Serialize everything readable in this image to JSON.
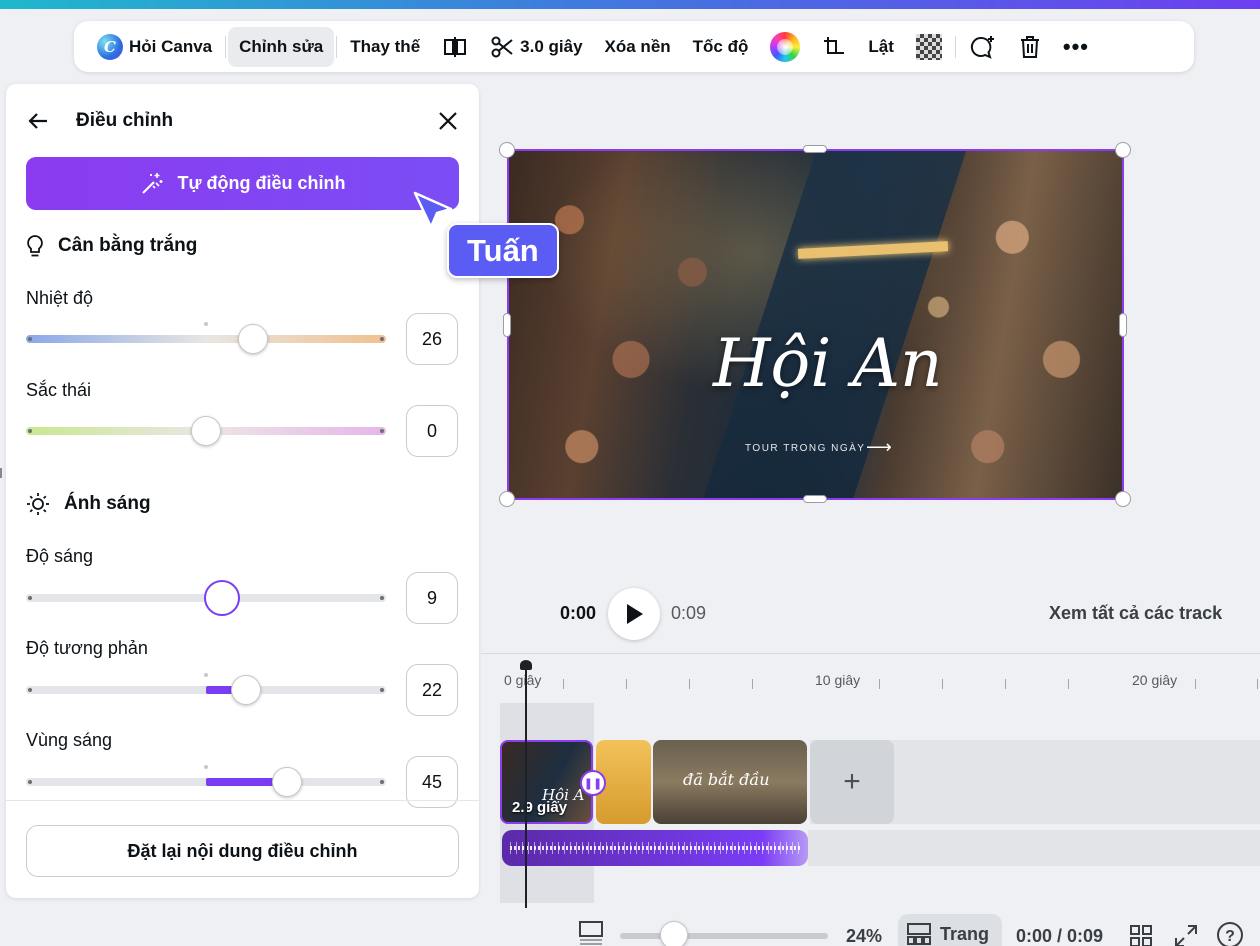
{
  "toolbar": {
    "ask_canva": "Hỏi Canva",
    "edit": "Chỉnh sửa",
    "replace": "Thay thế",
    "split_duration": "3.0 giây",
    "remove_bg": "Xóa nền",
    "speed": "Tốc độ",
    "flip": "Lật"
  },
  "panel": {
    "title": "Điều chỉnh",
    "auto_adjust": "Tự động điều chỉnh",
    "white_balance": {
      "title": "Cân bằng trắng",
      "temperature": {
        "label": "Nhiệt độ",
        "value": "26",
        "level": 0.63
      },
      "tint": {
        "label": "Sắc thái",
        "value": "0",
        "level": 0.5
      }
    },
    "light": {
      "title": "Ánh sáng",
      "brightness": {
        "label": "Độ sáng",
        "value": "9",
        "level": 0.545
      },
      "contrast": {
        "label": "Độ tương phản",
        "value": "22",
        "level": 0.61
      },
      "highlights": {
        "label": "Vùng sáng",
        "value": "45",
        "level": 0.725
      }
    },
    "reset": "Đặt lại nội dung điều chỉnh"
  },
  "collaborator": {
    "name": "Tuấn",
    "color": "#5b5cf3"
  },
  "preview": {
    "title": "Hội An",
    "subtitle": "TOUR TRONG NGÀY"
  },
  "playback": {
    "current": "0:00",
    "total": "0:09",
    "see_all_tracks": "Xem tất cả các track"
  },
  "timeline": {
    "ruler": [
      "0 giây",
      "10 giây",
      "20 giây"
    ],
    "clips": [
      {
        "label": "2.9 giây",
        "overlay": "Hội A"
      },
      {
        "label": ""
      },
      {
        "label": "đã bắt đầu"
      }
    ]
  },
  "bottom": {
    "zoom": "24%",
    "pages": "Trang",
    "time": "0:00 / 0:09"
  },
  "colors": {
    "accent": "#7a3df5"
  }
}
